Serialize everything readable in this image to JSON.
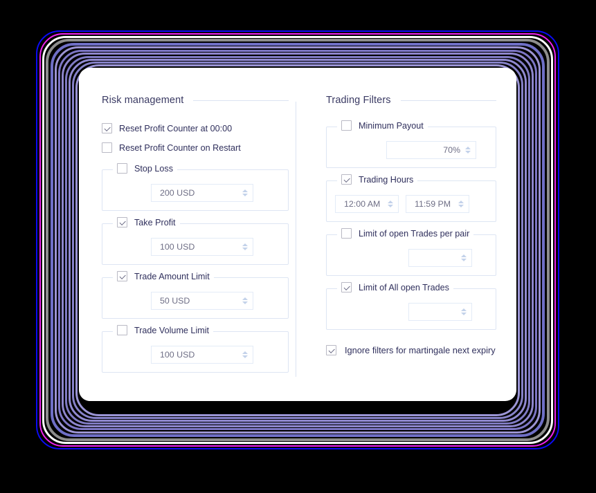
{
  "background": {
    "color": "#000000",
    "halo_colors": [
      "#0000ff",
      "#ff00ff",
      "#7a7aba",
      "#8f8f8f",
      "#ffffff",
      "#5b5bd6",
      "#9a8fd8"
    ]
  },
  "card": {
    "background": "#ffffff",
    "corner_radius": "16px"
  },
  "left_column": {
    "title": "Risk management",
    "checkboxes": [
      {
        "label": "Reset Profit Counter at 00:00",
        "checked": true
      },
      {
        "label": "Reset Profit Counter on Restart",
        "checked": false
      }
    ],
    "groups": [
      {
        "label": "Stop Loss",
        "checked": false,
        "value": "200 USD"
      },
      {
        "label": "Take Profit",
        "checked": true,
        "value": "100 USD"
      },
      {
        "label": "Trade Amount Limit",
        "checked": true,
        "value": "50 USD"
      },
      {
        "label": "Trade Volume Limit",
        "checked": false,
        "value": "100 USD"
      }
    ]
  },
  "right_column": {
    "title": "Trading Filters",
    "minimum_payout": {
      "label": "Minimum Payout",
      "checked": false,
      "value": "70%"
    },
    "trading_hours": {
      "label": "Trading Hours",
      "checked": true,
      "from": "12:00 AM",
      "to": "11:59 PM"
    },
    "limit_per_pair": {
      "label": "Limit of open Trades per pair",
      "checked": false,
      "value": ""
    },
    "limit_all": {
      "label": "Limit of All  open Trades",
      "checked": true,
      "value": ""
    },
    "ignore_filters": {
      "label": "Ignore filters for martingale next expiry",
      "checked": true
    }
  }
}
